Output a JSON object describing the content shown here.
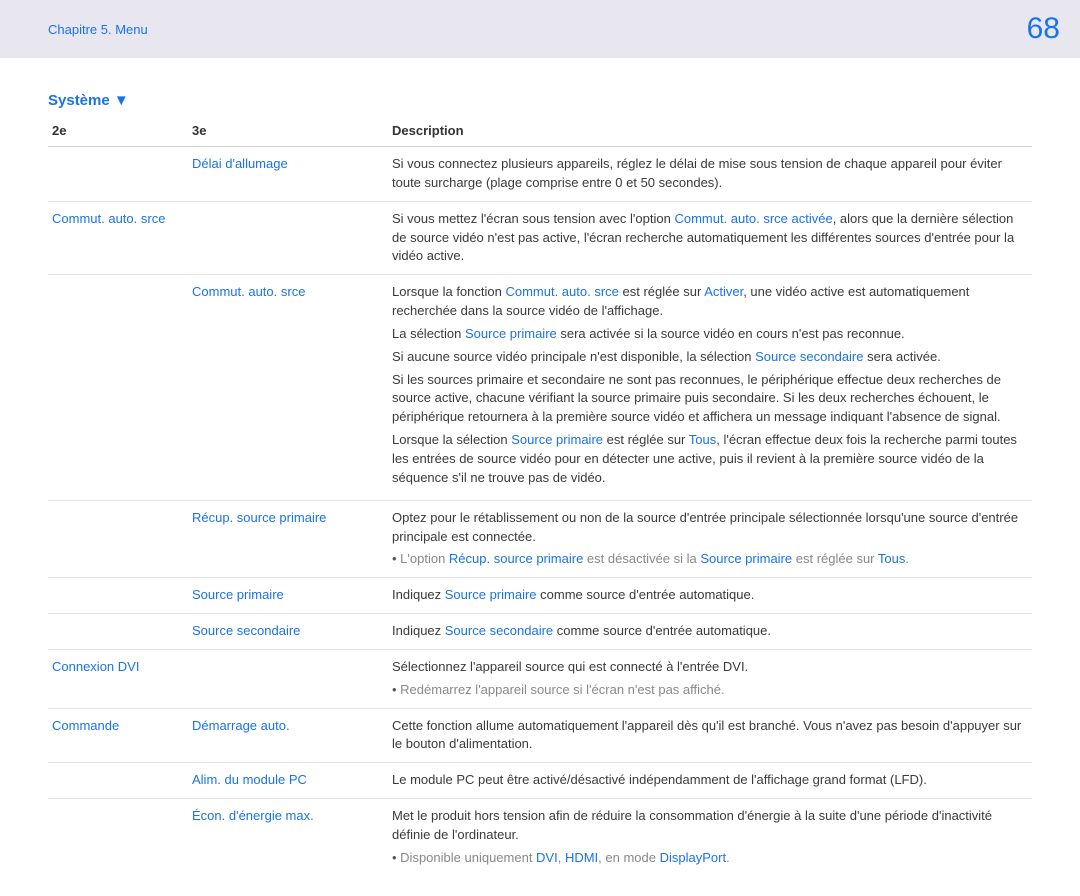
{
  "header": {
    "chapter": "Chapitre 5. Menu",
    "page": "68"
  },
  "section": "Système ▼",
  "thead": {
    "c1": "2e",
    "c2": "3e",
    "c3": "Description"
  },
  "rows": {
    "r0": {
      "c2": "Délai d'allumage",
      "c3": "Si vous connectez plusieurs appareils, réglez le délai de mise sous tension de chaque appareil pour éviter toute surcharge (plage comprise entre 0 et 50 secondes)."
    },
    "r1": {
      "c1": "Commut. auto. srce",
      "c3a": "Si vous mettez l'écran sous tension avec l'option ",
      "c3link": "Commut. auto. srce activée",
      "c3b": ", alors que la dernière sélection de source vidéo n'est pas active, l'écran recherche automatiquement les différentes sources d'entrée pour la vidéo active."
    },
    "r2": {
      "c2": "Commut. auto. srce",
      "p1a": "Lorsque la fonction ",
      "p1l1": "Commut. auto. srce",
      "p1b": " est réglée sur ",
      "p1l2": "Activer",
      "p1c": ", une vidéo active est automatiquement recherchée dans la source vidéo de l'affichage.",
      "p2a": "La sélection ",
      "p2l": "Source primaire",
      "p2b": " sera activée si la source vidéo en cours n'est pas reconnue.",
      "p3a": "Si aucune source vidéo principale n'est disponible, la sélection ",
      "p3l": "Source secondaire",
      "p3b": " sera activée.",
      "p4": "Si les sources primaire et secondaire ne sont pas reconnues, le périphérique effectue deux recherches de source active, chacune vérifiant la source primaire puis secondaire. Si les deux recherches échouent, le périphérique retournera à la première source vidéo et affichera un message indiquant l'absence de signal.",
      "p5a": "Lorsque la sélection ",
      "p5l1": "Source primaire",
      "p5b": " est réglée sur ",
      "p5l2": "Tous",
      "p5c": ", l'écran effectue deux fois la recherche parmi toutes les entrées de source vidéo pour en détecter une active, puis il revient à la première source vidéo de la séquence s'il ne trouve pas de vidéo."
    },
    "r3": {
      "c2": "Récup. source primaire",
      "p": "Optez pour le rétablissement ou non de la source d'entrée principale sélectionnée lorsqu'une source d'entrée principale est connectée.",
      "b1a": "L'option ",
      "b1l1": "Récup. source primaire",
      "b1b": " est désactivée si la ",
      "b1l2": "Source primaire",
      "b1c": " est réglée sur ",
      "b1l3": "Tous",
      "b1d": "."
    },
    "r4": {
      "c2": "Source primaire",
      "a": "Indiquez ",
      "l": "Source primaire",
      "b": " comme source d'entrée automatique."
    },
    "r5": {
      "c2": "Source secondaire",
      "a": "Indiquez ",
      "l": "Source secondaire",
      "b": " comme source d'entrée automatique."
    },
    "r6": {
      "c1": "Connexion DVI",
      "p": "Sélectionnez l'appareil source qui est connecté à l'entrée DVI.",
      "b": "Redémarrez l'appareil source si l'écran n'est pas affiché."
    },
    "r7": {
      "c1": "Commande",
      "c2": "Démarrage auto.",
      "p": "Cette fonction allume automatiquement l'appareil dès qu'il est branché. Vous n'avez pas besoin d'appuyer sur le bouton d'alimentation."
    },
    "r8": {
      "c2": "Alim. du module PC",
      "p": "Le module PC peut être activé/désactivé indépendamment de l'affichage grand format (LFD)."
    },
    "r9": {
      "c2": "Écon. d'énergie max.",
      "p": "Met le produit hors tension afin de réduire la consommation d'énergie à la suite d'une période d'inactivité définie de l'ordinateur.",
      "b1a": "Disponible uniquement ",
      "b1l1": "DVI",
      "b1s1": ", ",
      "b1l2": "HDMI",
      "b1s2": ", en mode ",
      "b1l3": "DisplayPort",
      "b1d": "."
    }
  }
}
